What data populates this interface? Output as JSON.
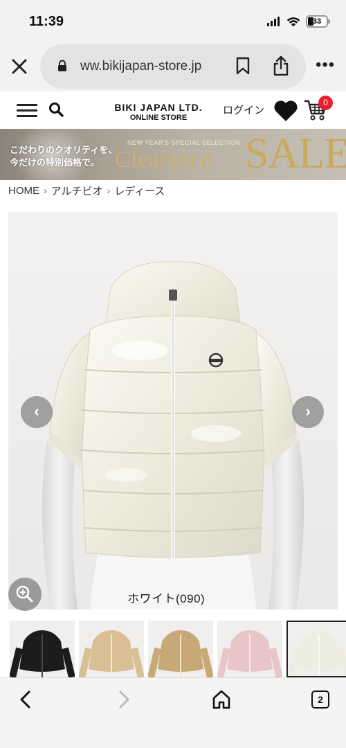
{
  "status_bar": {
    "time": "11:39",
    "battery": "33",
    "battery_level": 0.33
  },
  "browser": {
    "url": "ww.bikijapan-store.jp",
    "icons": [
      "close-icon",
      "lock-icon",
      "bookmark-icon",
      "share-icon",
      "more-icon"
    ],
    "more_label": "•••"
  },
  "header": {
    "logo_line1": "BIKI JAPAN LTD.",
    "logo_line2": "ONLINE STORE",
    "login_label": "ログイン",
    "cart_count": "0",
    "icons": [
      "menu-icon",
      "search-icon",
      "heart-icon",
      "cart-icon"
    ]
  },
  "banner": {
    "text_line1": "こだわりのクオリティを、",
    "text_line2": "今だけの特別価格で。",
    "kicker": "NEW YEAR'S SPECIAL SELECTION",
    "clearance": "Clearance",
    "sale": "SALE"
  },
  "breadcrumb": {
    "items": [
      "HOME",
      "アルチビオ",
      "レディース"
    ]
  },
  "product": {
    "caption": "ホワイト(090)",
    "prev_arrow": "‹",
    "next_arrow": "›",
    "colors": [
      "#ffffff",
      "#1c1c1c",
      "#d9bf94",
      "#c9a878",
      "#e8c6c8"
    ]
  },
  "thumbnails": [
    {
      "color": "black"
    },
    {
      "color": "champagne"
    },
    {
      "color": "gold"
    },
    {
      "color": "pink"
    },
    {
      "color": "white",
      "selected": true
    }
  ],
  "bottom_nav": {
    "tabs_count": "2",
    "icons": [
      "back-icon",
      "forward-icon",
      "home-icon",
      "tabs-icon"
    ]
  }
}
